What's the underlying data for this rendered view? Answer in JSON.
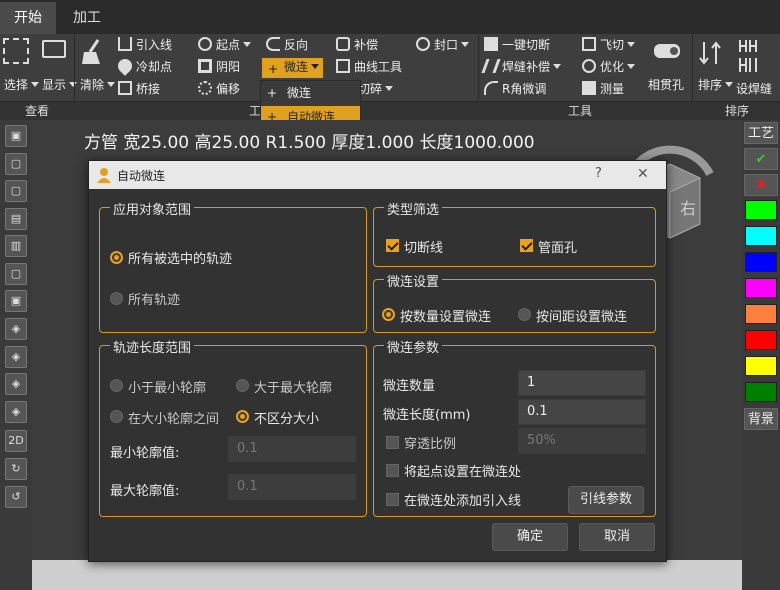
{
  "tabs": [
    {
      "label": "开始"
    },
    {
      "label": "加工"
    }
  ],
  "ribbon": {
    "select": "选择",
    "display": "显示",
    "clear": "清除",
    "lead_line": "引入线",
    "cool_point": "冷却点",
    "bridge": "桥接",
    "start_point": "起点",
    "yin_yang": "阴阳",
    "offset": "偏移",
    "reverse": "反向",
    "micro": "微连",
    "compensate": "补偿",
    "curve_tool": "曲线工具",
    "cut_broken": "切碎",
    "seal": "封口",
    "one_key_cut": "一键切断",
    "weld_comp": "焊缝补偿",
    "r_angle": "R角微调",
    "fly_cut": "飞切",
    "optimize": "优化",
    "measure": "测量",
    "through_hole": "相贯孔",
    "sort": "排序",
    "set_seam": "设焊缝"
  },
  "groups": {
    "view": "查看",
    "tool_partial": "工",
    "tools": "工具",
    "sort": "排序"
  },
  "dropdown": {
    "item1": "微连",
    "item2": "自动微连"
  },
  "left_tools": {
    "label_2d": "2D"
  },
  "right_panel": {
    "craft": "工艺",
    "background": "背景",
    "check": "✔",
    "cross": "✖",
    "swatches": [
      "#00ff00",
      "#00ffff",
      "#0000ff",
      "#ff00ff",
      "#ff7f3f",
      "#ff0000",
      "#ffff00",
      "#008000"
    ]
  },
  "info": "方管 宽25.00 高25.00 R1.500 厚度1.000 长度1000.000",
  "viewcube": {
    "face": "右"
  },
  "dialog": {
    "title": "自动微连",
    "help": "?",
    "close": "✕",
    "scope": {
      "legend": "应用对象范围",
      "opt1": "所有被选中的轨迹",
      "opt2": "所有轨迹"
    },
    "type": {
      "legend": "类型筛选",
      "cut_line": "切断线",
      "pipe_hole": "管面孔"
    },
    "settings": {
      "legend": "微连设置",
      "by_count": "按数量设置微连",
      "by_spacing": "按间距设置微连"
    },
    "length": {
      "legend": "轨迹长度范围",
      "lt_min": "小于最小轮廓",
      "gt_max": "大于最大轮廓",
      "between": "在大小轮廓之间",
      "no_distinction": "不区分大小",
      "min_label": "最小轮廓值:",
      "min_value": "0.1",
      "max_label": "最大轮廓值:",
      "max_value": "0.1"
    },
    "params": {
      "legend": "微连参数",
      "count_label": "微连数量",
      "count_value": "1",
      "length_label": "微连长度(mm)",
      "length_value": "0.1",
      "ratio_label": "穿透比例",
      "ratio_value": "50%",
      "start_label": "将起点设置在微连处",
      "lead_label": "在微连处添加引入线",
      "lead_btn": "引线参数"
    },
    "ok": "确定",
    "cancel": "取消"
  }
}
